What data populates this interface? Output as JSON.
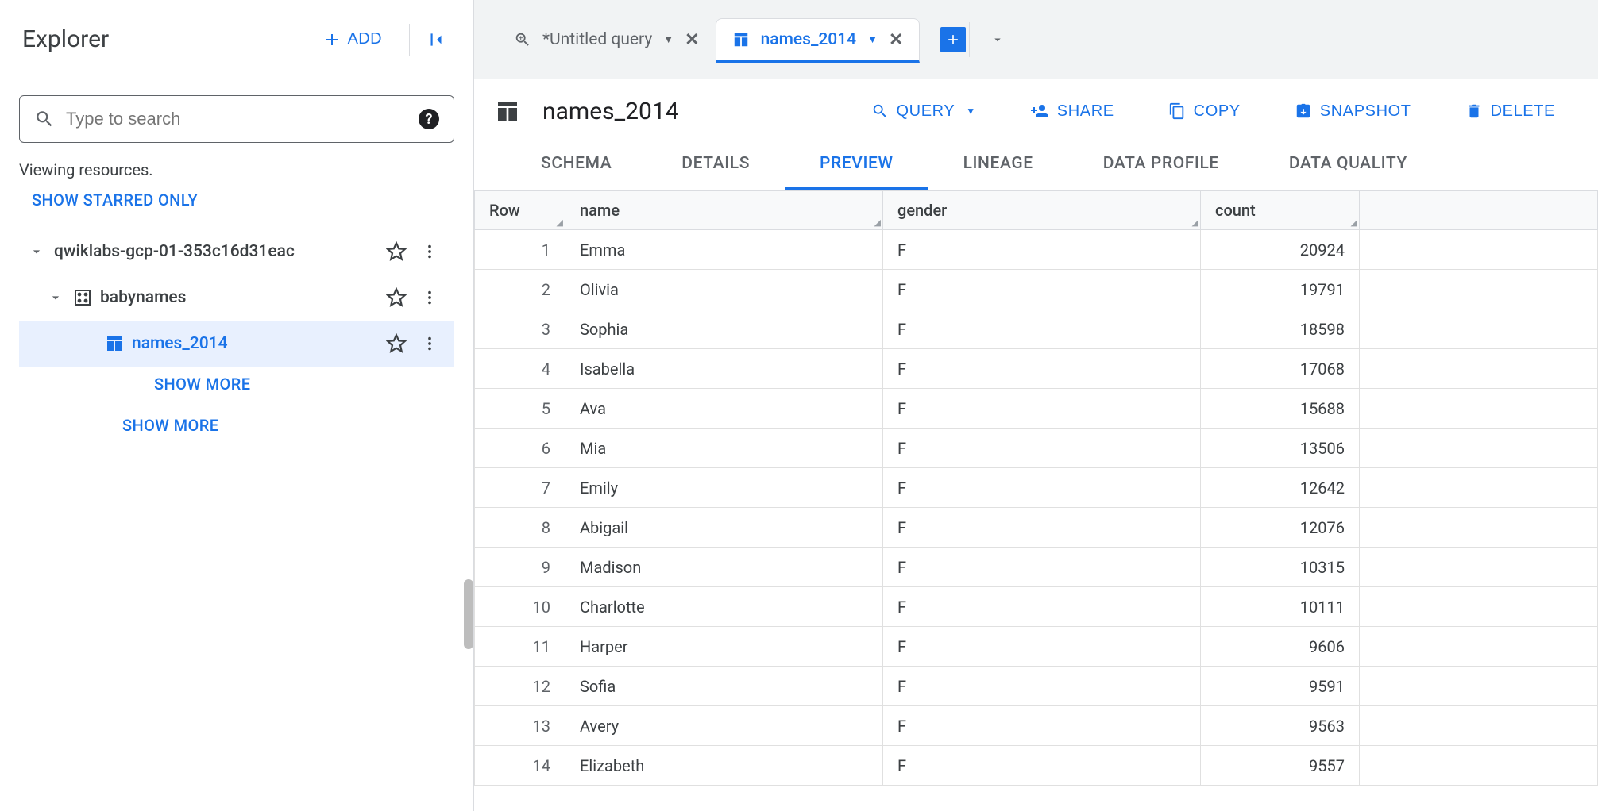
{
  "sidebar": {
    "title": "Explorer",
    "add_label": "ADD",
    "search_placeholder": "Type to search",
    "viewing_label": "Viewing resources.",
    "starred_label": "SHOW STARRED ONLY",
    "project": {
      "label": "qwiklabs-gcp-01-353c16d31eac"
    },
    "dataset": {
      "label": "babynames"
    },
    "table_item": {
      "label": "names_2014"
    },
    "show_more_1": "SHOW MORE",
    "show_more_2": "SHOW MORE"
  },
  "tabs": {
    "query": {
      "label": "*Untitled query"
    },
    "table": {
      "label": "names_2014"
    }
  },
  "header": {
    "title": "names_2014",
    "actions": {
      "query": "QUERY",
      "share": "SHARE",
      "copy": "COPY",
      "snapshot": "SNAPSHOT",
      "delete": "DELETE"
    }
  },
  "subtabs": {
    "schema": "SCHEMA",
    "details": "DETAILS",
    "preview": "PREVIEW",
    "lineage": "LINEAGE",
    "data_profile": "DATA PROFILE",
    "data_quality": "DATA QUALITY"
  },
  "table": {
    "columns": {
      "row": "Row",
      "name": "name",
      "gender": "gender",
      "count": "count"
    },
    "rows": [
      {
        "n": "1",
        "name": "Emma",
        "gender": "F",
        "count": "20924"
      },
      {
        "n": "2",
        "name": "Olivia",
        "gender": "F",
        "count": "19791"
      },
      {
        "n": "3",
        "name": "Sophia",
        "gender": "F",
        "count": "18598"
      },
      {
        "n": "4",
        "name": "Isabella",
        "gender": "F",
        "count": "17068"
      },
      {
        "n": "5",
        "name": "Ava",
        "gender": "F",
        "count": "15688"
      },
      {
        "n": "6",
        "name": "Mia",
        "gender": "F",
        "count": "13506"
      },
      {
        "n": "7",
        "name": "Emily",
        "gender": "F",
        "count": "12642"
      },
      {
        "n": "8",
        "name": "Abigail",
        "gender": "F",
        "count": "12076"
      },
      {
        "n": "9",
        "name": "Madison",
        "gender": "F",
        "count": "10315"
      },
      {
        "n": "10",
        "name": "Charlotte",
        "gender": "F",
        "count": "10111"
      },
      {
        "n": "11",
        "name": "Harper",
        "gender": "F",
        "count": "9606"
      },
      {
        "n": "12",
        "name": "Sofia",
        "gender": "F",
        "count": "9591"
      },
      {
        "n": "13",
        "name": "Avery",
        "gender": "F",
        "count": "9563"
      },
      {
        "n": "14",
        "name": "Elizabeth",
        "gender": "F",
        "count": "9557"
      }
    ]
  }
}
